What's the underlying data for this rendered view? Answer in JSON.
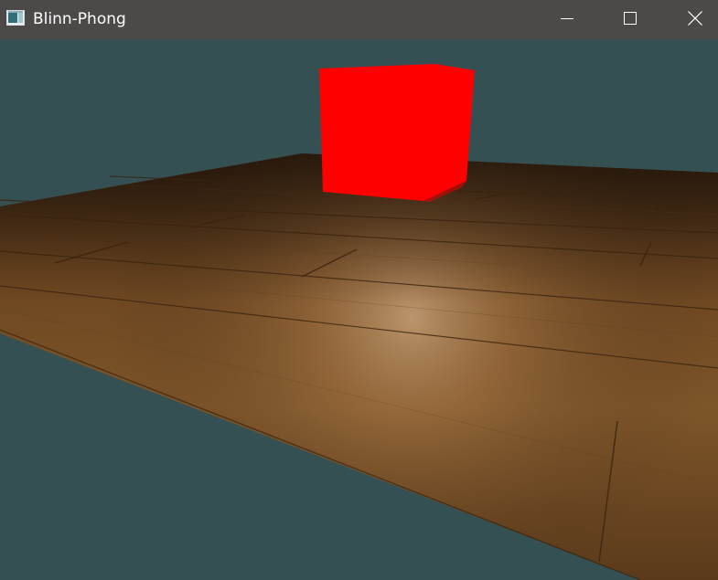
{
  "window": {
    "title": "Blinn-Phong",
    "icon": "app-window-icon",
    "controls": {
      "minimize_icon": "minimize-icon",
      "maximize_icon": "maximize-icon",
      "close_icon": "close-icon"
    }
  },
  "scene": {
    "clear_color": "#345052",
    "floor_color": "#7a5026",
    "cube_color": "#ff0000",
    "highlight_color": "#c69a6c"
  }
}
